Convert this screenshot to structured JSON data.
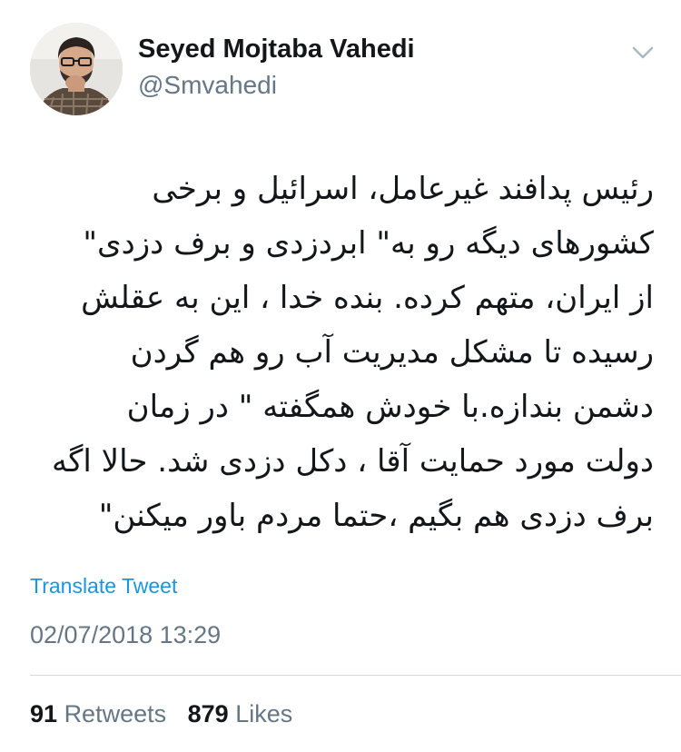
{
  "author": {
    "name": "Seyed Mojtaba Vahedi",
    "handle": "@Smvahedi"
  },
  "tweet": {
    "lines": [
      "رئیس پدافند غیرعامل، اسرائیل و برخی",
      "کشورهای دیگه رو به\" ابردزدی و برف دزدی\"",
      "از ایران، متهم کرده. بنده خدا ، این به عقلش",
      "رسیده تا مشکل مدیریت آب  رو  هم گردن",
      "دشمن  بندازه.با خودش همگفته \" در زمان",
      "دولت مورد حمایت آقا ، دکل دزدی شد. حالا اگه",
      "برف دزدی هم بگیم ،حتما مردم باور میکنن\""
    ],
    "translate_label": "Translate Tweet",
    "timestamp": "02/07/2018 13:29"
  },
  "stats": {
    "retweets_count": "91",
    "retweets_label": "Retweets",
    "likes_count": "879",
    "likes_label": "Likes"
  },
  "icons": {
    "menu": "chevron-down-icon"
  },
  "colors": {
    "link": "#1b95e0",
    "secondary_text": "#657786",
    "primary_text": "#14171a",
    "divider": "#d6d9dc"
  }
}
